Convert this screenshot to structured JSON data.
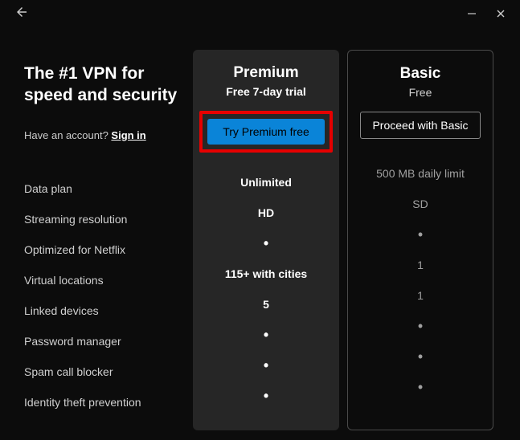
{
  "header": {
    "headline": "The #1 VPN for speed and security",
    "account_prompt": "Have an account? ",
    "signin": "Sign in"
  },
  "features": [
    "Data plan",
    "Streaming resolution",
    "Optimized for Netflix",
    "Virtual locations",
    "Linked devices",
    "Password manager",
    "Spam call blocker",
    "Identity theft prevention"
  ],
  "plans": {
    "premium": {
      "title": "Premium",
      "subtitle": "Free 7-day trial",
      "cta": "Try Premium free",
      "values": [
        "Unlimited",
        "HD",
        "•",
        "115+ with cities",
        "5",
        "•",
        "•",
        "•"
      ]
    },
    "basic": {
      "title": "Basic",
      "subtitle": "Free",
      "cta": "Proceed with Basic",
      "values": [
        "500 MB daily limit",
        "SD",
        "•",
        "1",
        "1",
        "•",
        "•",
        "•"
      ]
    }
  }
}
